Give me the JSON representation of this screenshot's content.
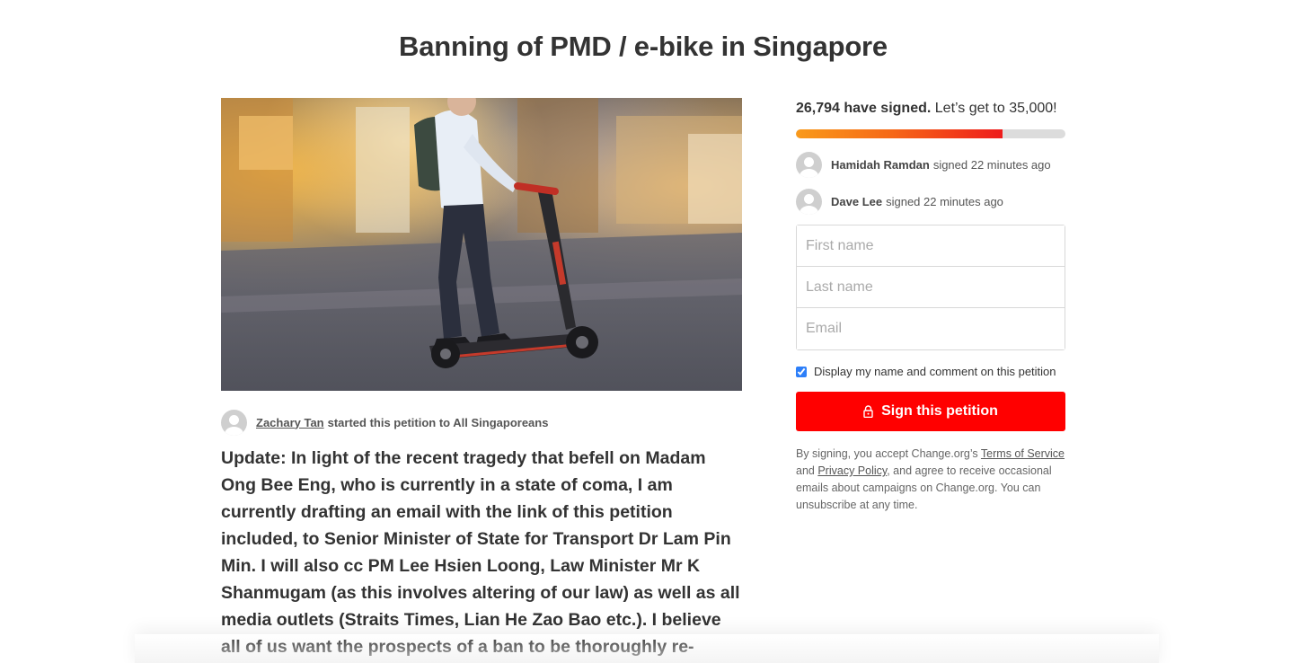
{
  "petition": {
    "title": "Banning of PMD / e-bike in Singapore",
    "image_icon": "photo-man-on-e-scooter",
    "starter_name": "Zachary Tan",
    "starter_suffix": "started this petition to All Singaporeans",
    "body": "Update: In light of the recent tragedy that befell on Madam Ong Bee Eng, who is currently in a state of coma, I am currently drafting an email with the link of this petition included, to Senior Minister of State for Transport Dr Lam Pin Min. I will also cc PM Lee Hsien Loong, Law Minister Mr K Shanmugam (as this involves altering of our law) as well as all media outlets (Straits Times, Lian He Zao Bao etc.). I believe all of us want the prospects of a ban to be thoroughly re-"
  },
  "sidebar": {
    "signed_count": "26,794 have signed.",
    "goal_text": "Let’s get to 35,000!",
    "progress_fraction": 0.7655,
    "recent_signers": [
      {
        "name": "Hamidah Ramdan",
        "action": "signed 22 minutes ago"
      },
      {
        "name": "Dave Lee",
        "action": "signed 22 minutes ago"
      }
    ],
    "form": {
      "first_name_placeholder": "First name",
      "last_name_placeholder": "Last name",
      "email_placeholder": "Email"
    },
    "checkbox_label": "Display my name and comment on this petition",
    "checkbox_checked": true,
    "sign_button_label": "Sign this petition",
    "legal": {
      "prefix": "By signing, you accept Change.org’s ",
      "terms": "Terms of Service",
      "and": " and ",
      "privacy": "Privacy Policy",
      "suffix": ", and agree to receive occasional emails about campaigns on Change.org. You can unsubscribe at any time."
    }
  },
  "colors": {
    "accent": "#ff0000",
    "progress_start": "#f99a1b",
    "progress_end": "#ee1c1c",
    "progress_track": "#dcdcdc",
    "text": "#333333"
  }
}
